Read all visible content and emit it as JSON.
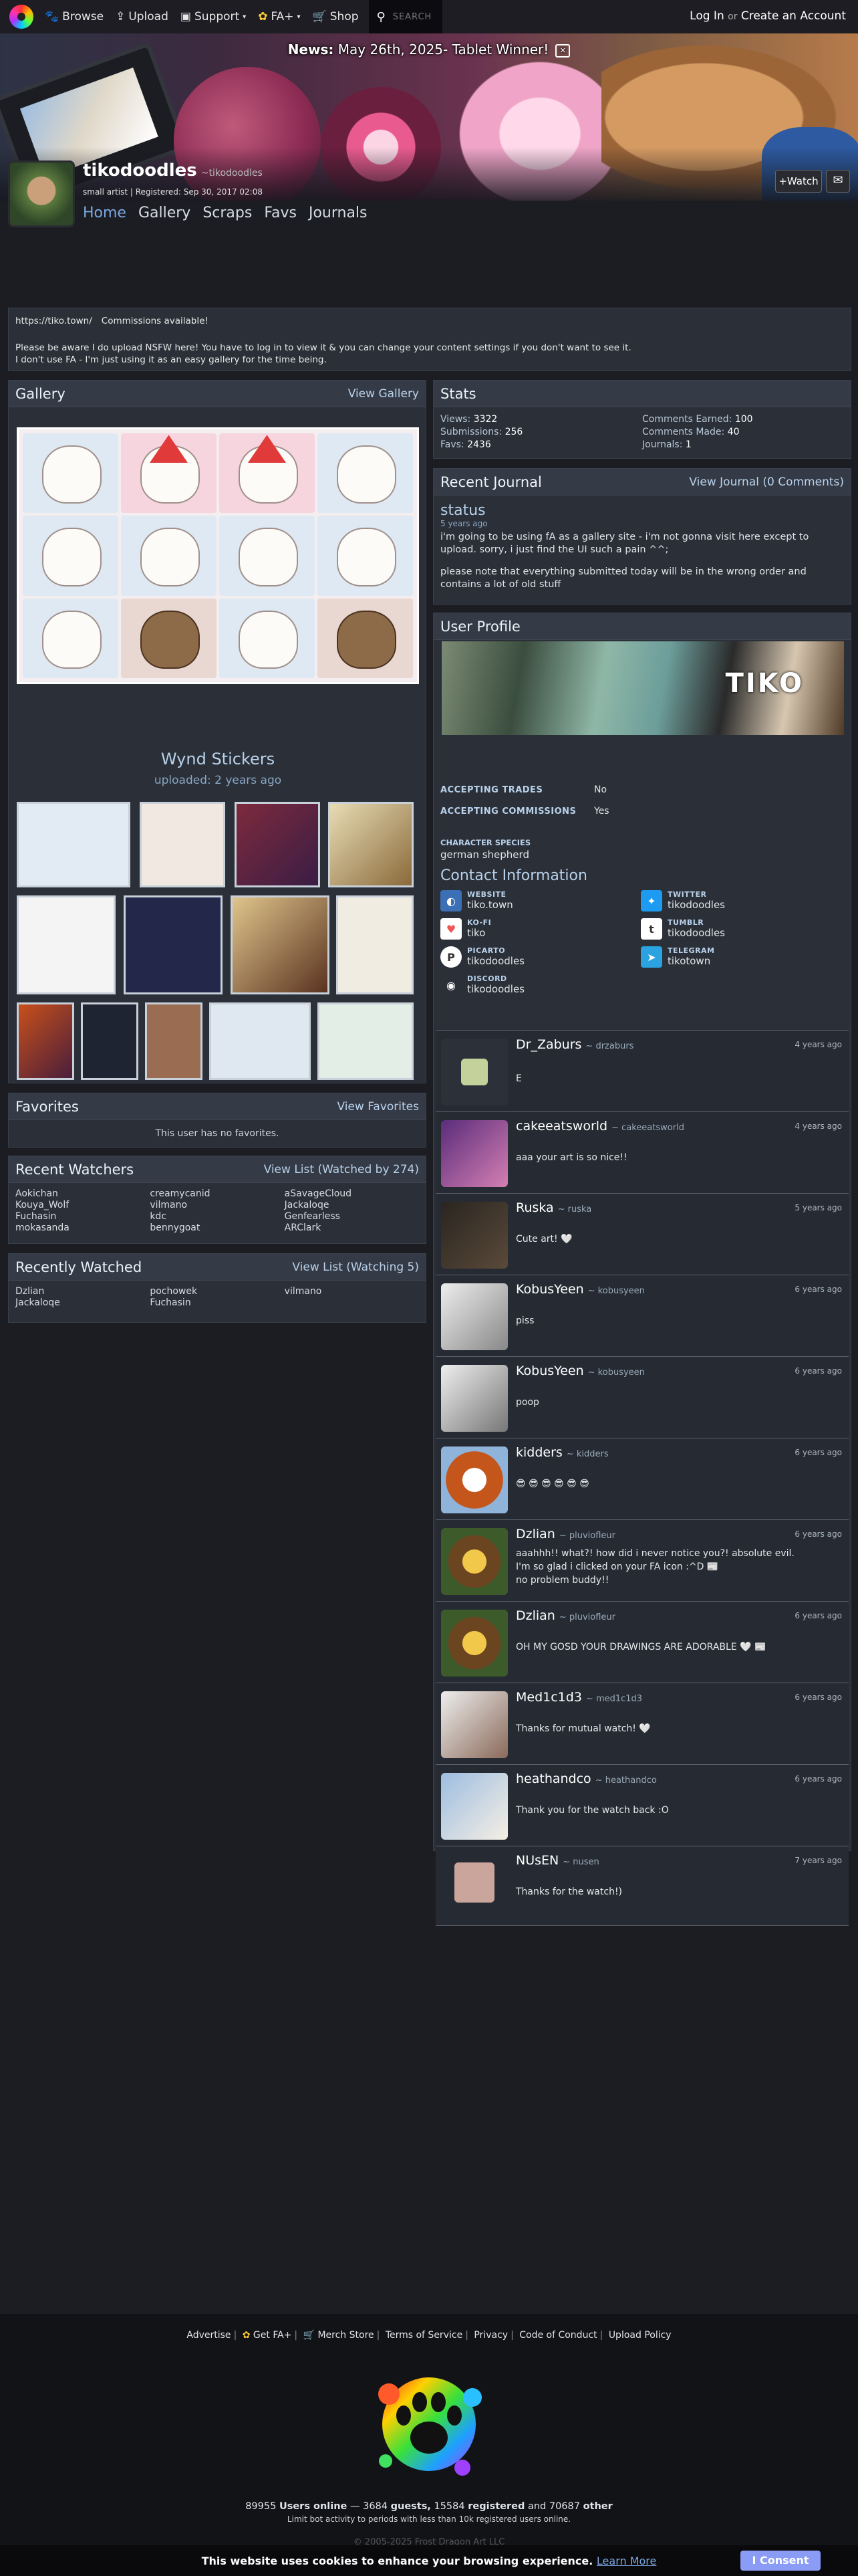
{
  "nav": {
    "items": [
      {
        "icon": "browse",
        "label": "Browse"
      },
      {
        "icon": "upload",
        "label": "Upload"
      },
      {
        "icon": "support",
        "label": "Support"
      },
      {
        "icon": "paw",
        "label": "FA+"
      },
      {
        "icon": "cart",
        "label": "Shop"
      }
    ],
    "search_placeholder": "SEARCH",
    "login": "Log In",
    "or": "or",
    "create": "Create an Account"
  },
  "news": {
    "label": "News:",
    "text": "May 26th, 2025- Tablet Winner!"
  },
  "user": {
    "name": "tikodoodles",
    "handle": "~tikodoodles",
    "subtitle": "small artist | Registered: Sep 30, 2017 02:08",
    "watch": "+Watch",
    "tabs": [
      "Home",
      "Gallery",
      "Scraps",
      "Favs",
      "Journals"
    ]
  },
  "profile_box": {
    "link": "https://tiko.town/",
    "commissions": "Commissions available!",
    "line1": "Please be aware I do upload NSFW here! You have to log in to view it & you can change your content settings if you don't want to see it.",
    "line2": "I don't use FA - I'm just using it as an easy gallery for the time being."
  },
  "gallery": {
    "title": "Gallery",
    "view": "View Gallery",
    "featured_title": "Wynd Stickers",
    "featured_date": "uploaded: 2 years ago"
  },
  "stats": {
    "title": "Stats",
    "views_label": "Views:",
    "views": "3322",
    "subs_label": "Submissions:",
    "subs": "256",
    "favs_label": "Favs:",
    "favs": "2436",
    "ce_label": "Comments Earned:",
    "ce": "100",
    "cm_label": "Comments Made:",
    "cm": "40",
    "jn_label": "Journals:",
    "jn": "1"
  },
  "journal": {
    "title": "Recent Journal",
    "view": "View Journal (0 Comments)",
    "jtitle": "status",
    "jdate": "5 years ago",
    "p1": "i'm going to be using fA as a gallery site - i'm not gonna visit here except to upload. sorry, i just find the UI such a pain ^^;",
    "p2": "please note that everything submitted today will be in the wrong order and contains a lot of old stuff"
  },
  "uprofile": {
    "title": "User Profile",
    "banner_text": "TIKO",
    "trades_label": "ACCEPTING TRADES",
    "trades": "No",
    "comm_label": "ACCEPTING COMMISSIONS",
    "comm": "Yes",
    "species_label": "CHARACTER SPECIES",
    "species": "german shepherd",
    "contact_title": "Contact Information",
    "contacts": [
      {
        "label": "WEBSITE",
        "value": "tiko.town"
      },
      {
        "label": "TWITTER",
        "value": "tikodoodles"
      },
      {
        "label": "KO-FI",
        "value": "tiko"
      },
      {
        "label": "TUMBLR",
        "value": "tikodoodles"
      },
      {
        "label": "PICARTO",
        "value": "tikodoodles"
      },
      {
        "label": "TELEGRAM",
        "value": "tikotown"
      },
      {
        "label": "DISCORD",
        "value": "tikodoodles"
      }
    ]
  },
  "comments": [
    {
      "name": "Dr_Zaburs",
      "handle": "~ drzaburs",
      "date": "4 years ago",
      "text": "E"
    },
    {
      "name": "cakeeatsworld",
      "handle": "~ cakeeatsworld",
      "date": "4 years ago",
      "text": "aaa your art is so nice!!"
    },
    {
      "name": "Ruska",
      "handle": "~ ruska",
      "date": "5 years ago",
      "text": "Cute art! 🤍"
    },
    {
      "name": "KobusYeen",
      "handle": "~ kobusyeen",
      "date": "6 years ago",
      "text": "piss"
    },
    {
      "name": "KobusYeen",
      "handle": "~ kobusyeen",
      "date": "6 years ago",
      "text": "poop"
    },
    {
      "name": "kidders",
      "handle": "~ kidders",
      "date": "6 years ago",
      "text": "😎 😎 😎 😎 😎 😎"
    },
    {
      "name": "Dzlian",
      "handle": "~ pluviofleur",
      "date": "6 years ago",
      "text": "aaahhh!! what?! how did i never notice you?! absolute evil.\nI'm so glad i clicked on your FA icon :^D 📰\nno problem buddy!!"
    },
    {
      "name": "Dzlian",
      "handle": "~ pluviofleur",
      "date": "6 years ago",
      "text": "OH MY GOSD YOUR DRAWINGS ARE ADORABLE 🤍 📰"
    },
    {
      "name": "Med1c1d3",
      "handle": "~ med1c1d3",
      "date": "6 years ago",
      "text": "Thanks for mutual watch! 🤍"
    },
    {
      "name": "heathandco",
      "handle": "~ heathandco",
      "date": "6 years ago",
      "text": "Thank you for the watch back :O"
    },
    {
      "name": "NUsEN",
      "handle": "~ nusen",
      "date": "7 years ago",
      "text": "Thanks for the watch!)"
    }
  ],
  "favorites": {
    "title": "Favorites",
    "view": "View Favorites",
    "none": "This user has no favorites."
  },
  "watchers": {
    "title": "Recent Watchers",
    "view": "View List (Watched by 274)",
    "names": [
      "Aokichan",
      "creamycanid",
      "aSavageCloud",
      "Kouya_Wolf",
      "vilmano",
      "Jackaloqe",
      "Fuchasin",
      "kdc",
      "Genfearless",
      "mokasanda",
      "bennygoat",
      "ARClark"
    ]
  },
  "watched": {
    "title": "Recently Watched",
    "view": "View List (Watching 5)",
    "names": [
      "Dzlian",
      "pochowek",
      "vilmano",
      "Jackaloqe",
      "Fuchasin"
    ]
  },
  "footer": {
    "links": [
      "Advertise",
      "Get FA+",
      "Merch Store",
      "Terms of Service",
      "Privacy",
      "Code of Conduct",
      "Upload Policy"
    ],
    "online_total": "89955",
    "online_label": "Users online",
    "guests": "3684",
    "guests_label": "guests,",
    "registered": "15584",
    "registered_label": "registered",
    "and": "and",
    "other": "70687",
    "other_label": "other",
    "limit": "Limit bot activity to periods with less than 10k registered users online.",
    "copy": "© 2005-2025 Frost Dragon Art LLC",
    "cookie": "This website uses cookies to enhance your browsing experience.",
    "learn": "Learn More",
    "consent": "I Consent"
  }
}
